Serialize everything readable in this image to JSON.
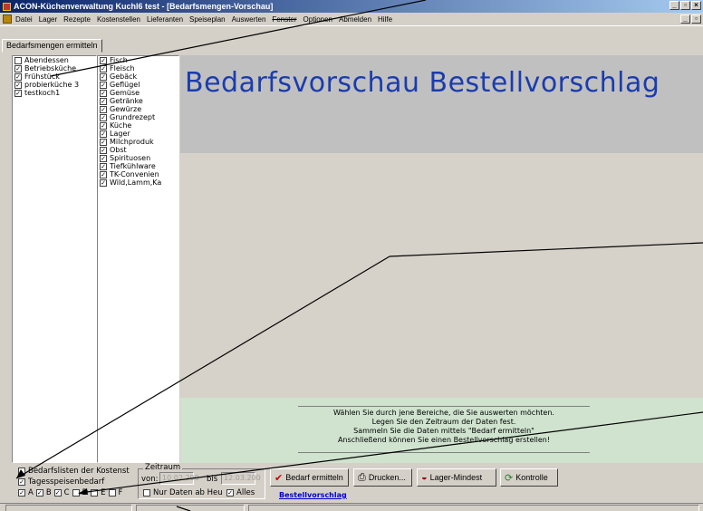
{
  "window": {
    "title": "ACON-Küchenverwaltung Kuchl6 test - [Bedarfsmengen-Vorschau]",
    "controls": [
      "_",
      "▫",
      "×"
    ]
  },
  "menu": [
    "Datei",
    "Lager",
    "Rezepte",
    "Kostenstellen",
    "Lieferanten",
    "Speiseplan",
    "Auswerten",
    "Fenster",
    "Optionen",
    "Abmelden",
    "Hilfe"
  ],
  "tab": {
    "label": "Bedarfsmengen ermitteln"
  },
  "kitchens": [
    {
      "label": "Abendessen",
      "checked": false
    },
    {
      "label": "Betriebsküche",
      "checked": true
    },
    {
      "label": "Frühstück",
      "checked": true
    },
    {
      "label": "probierküche 3",
      "checked": true
    },
    {
      "label": "testkoch1",
      "checked": true
    }
  ],
  "categories": [
    {
      "label": "Fisch",
      "checked": true
    },
    {
      "label": "Fleisch",
      "checked": true
    },
    {
      "label": "Gebäck",
      "checked": true
    },
    {
      "label": "Geflügel",
      "checked": true
    },
    {
      "label": "Gemüse",
      "checked": true
    },
    {
      "label": "Getränke",
      "checked": true
    },
    {
      "label": "Gewürze",
      "checked": true
    },
    {
      "label": "Grundrezept",
      "checked": true
    },
    {
      "label": "Küche",
      "checked": true
    },
    {
      "label": "Lager",
      "checked": true
    },
    {
      "label": "Milchproduk",
      "checked": true
    },
    {
      "label": "Obst",
      "checked": true
    },
    {
      "label": "Spirituosen",
      "checked": true
    },
    {
      "label": "Tiefkühlware",
      "checked": true
    },
    {
      "label": "TK-Convenien",
      "checked": true
    },
    {
      "label": "Wild,Lamm,Ka",
      "checked": true
    }
  ],
  "main": {
    "title": "Bedarfsvorschau  Bestellvorschlag",
    "info_lines": [
      "Wählen Sie durch jene Bereiche, die Sie auswerten möchten.",
      "Legen Sie den Zeitraum der Daten fest.",
      "Sammeln Sie die Daten mittels \"Bedarf ermitteln\"",
      "Anschließend können Sie einen Bestellvorschlag erstellen!"
    ]
  },
  "bottom": {
    "chk_bedarfslisten": {
      "label": "Bedarfslisten der Kostenst",
      "checked": false
    },
    "chk_tagesspeise": {
      "label": "Tagesspeisenbedarf",
      "checked": true
    },
    "abc": [
      {
        "label": "A",
        "checked": true
      },
      {
        "label": "B",
        "checked": true
      },
      {
        "label": "C",
        "checked": true
      },
      {
        "label": "D",
        "checked": false
      },
      {
        "label": "E",
        "checked": false
      },
      {
        "label": "F",
        "checked": false
      }
    ],
    "zeitraum_label": "Zeitraum",
    "von_label": "von:",
    "von_value": "10.02.200",
    "bis_label": "bis",
    "bis_value": "12.03.200",
    "chk_nur_daten": {
      "label": "Nur Daten ab Heu",
      "checked": false
    },
    "chk_alles": {
      "label": "Alles",
      "checked": true
    },
    "btn_bedarf": "Bedarf ermitteln",
    "btn_drucken": "Drucken...",
    "btn_lager": "Lager-Mindest",
    "btn_kontrolle": "Kontrolle",
    "link_bestellvorschlag": "Bestellvorschlag"
  },
  "colors": {
    "title_blue": "#1a3caf",
    "header_gray": "#c0c0c0",
    "info_green": "#cfe3cf",
    "link_blue": "#0000cc"
  }
}
